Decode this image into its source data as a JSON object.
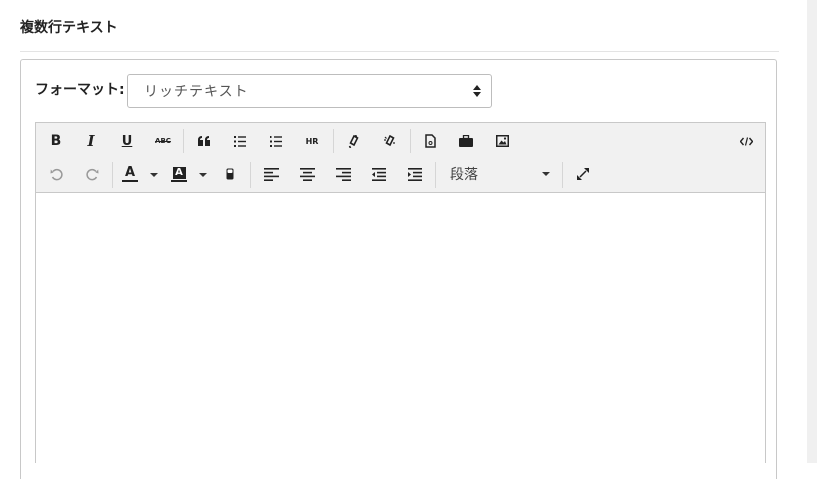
{
  "section": {
    "title": "複数行テキスト"
  },
  "format": {
    "label": "フォーマット:",
    "selected": "リッチテキスト"
  },
  "editor": {
    "paragraph_style": "段落",
    "content": ""
  },
  "toolbar": {
    "bold_label": "B",
    "italic_label": "I",
    "underline_label": "U",
    "strike_label": "ABC",
    "hr_label": "HR",
    "font_color_letter": "A",
    "highlight_letter": "A"
  }
}
